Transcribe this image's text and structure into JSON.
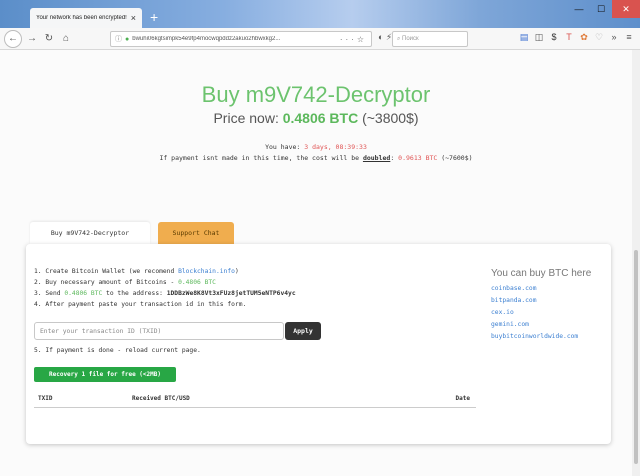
{
  "browser": {
    "tab_title": "Your network has been encrypted!",
    "url": "bwuhi06kgtsimpk54e9fp4mocwqpddz2akuo2hbwxkg2...",
    "search_placeholder": "Поиск"
  },
  "page": {
    "title": "Buy m9V742-Decryptor",
    "price_label": "Price now: ",
    "price_btc": "0.4806 BTC",
    "price_usd": " (~3800$)",
    "you_have_label": "You have: ",
    "you_have_value": "3 days, 08:39:33",
    "warn_prefix": "If payment isnt made in this time, the cost will be ",
    "warn_doubled": "doubled",
    "warn_colon": ": ",
    "warn_value": "0.9613 BTC",
    "warn_usd": " (~7600$)"
  },
  "tabs": {
    "buy": "Buy m9V742-Decryptor",
    "support": "Support Chat"
  },
  "steps": {
    "s1_prefix": "1. Create Bitcoin Wallet (we recomend ",
    "s1_link": "Blockchain.info",
    "s1_suffix": ")",
    "s2_prefix": "2. Buy necessary amount of Bitcoins - ",
    "s2_value": "0.4806 BTC",
    "s3_prefix": "3. Send ",
    "s3_value": "0.4806 BTC",
    "s3_mid": " to the address: ",
    "s3_address": "1DDBzWe8K8Vt3xFUz8jetTUM5eNTP6v4yc",
    "s4": "4. After payment paste your transaction id in this form.",
    "s5": "5. If payment is done - reload current page."
  },
  "form": {
    "placeholder": "Enter your transaction ID (TXID)",
    "apply": "Apply"
  },
  "recovery_button": "Recovery 1 file for free (<2MB)",
  "table": {
    "headers": [
      "TXID",
      "Received BTC/USD",
      "Date"
    ]
  },
  "buy_panel": {
    "title": "You can buy BTC here",
    "links": [
      "coinbase.com",
      "bitpanda.com",
      "cex.io",
      "gemini.com",
      "buybitcoinworldwide.com"
    ]
  },
  "colors": {
    "title_green": "#6cc36e",
    "accent_red": "#e05555",
    "support_orange": "#f0ad4e",
    "recovery_green": "#28a745",
    "link_blue": "#3b7fd1"
  }
}
